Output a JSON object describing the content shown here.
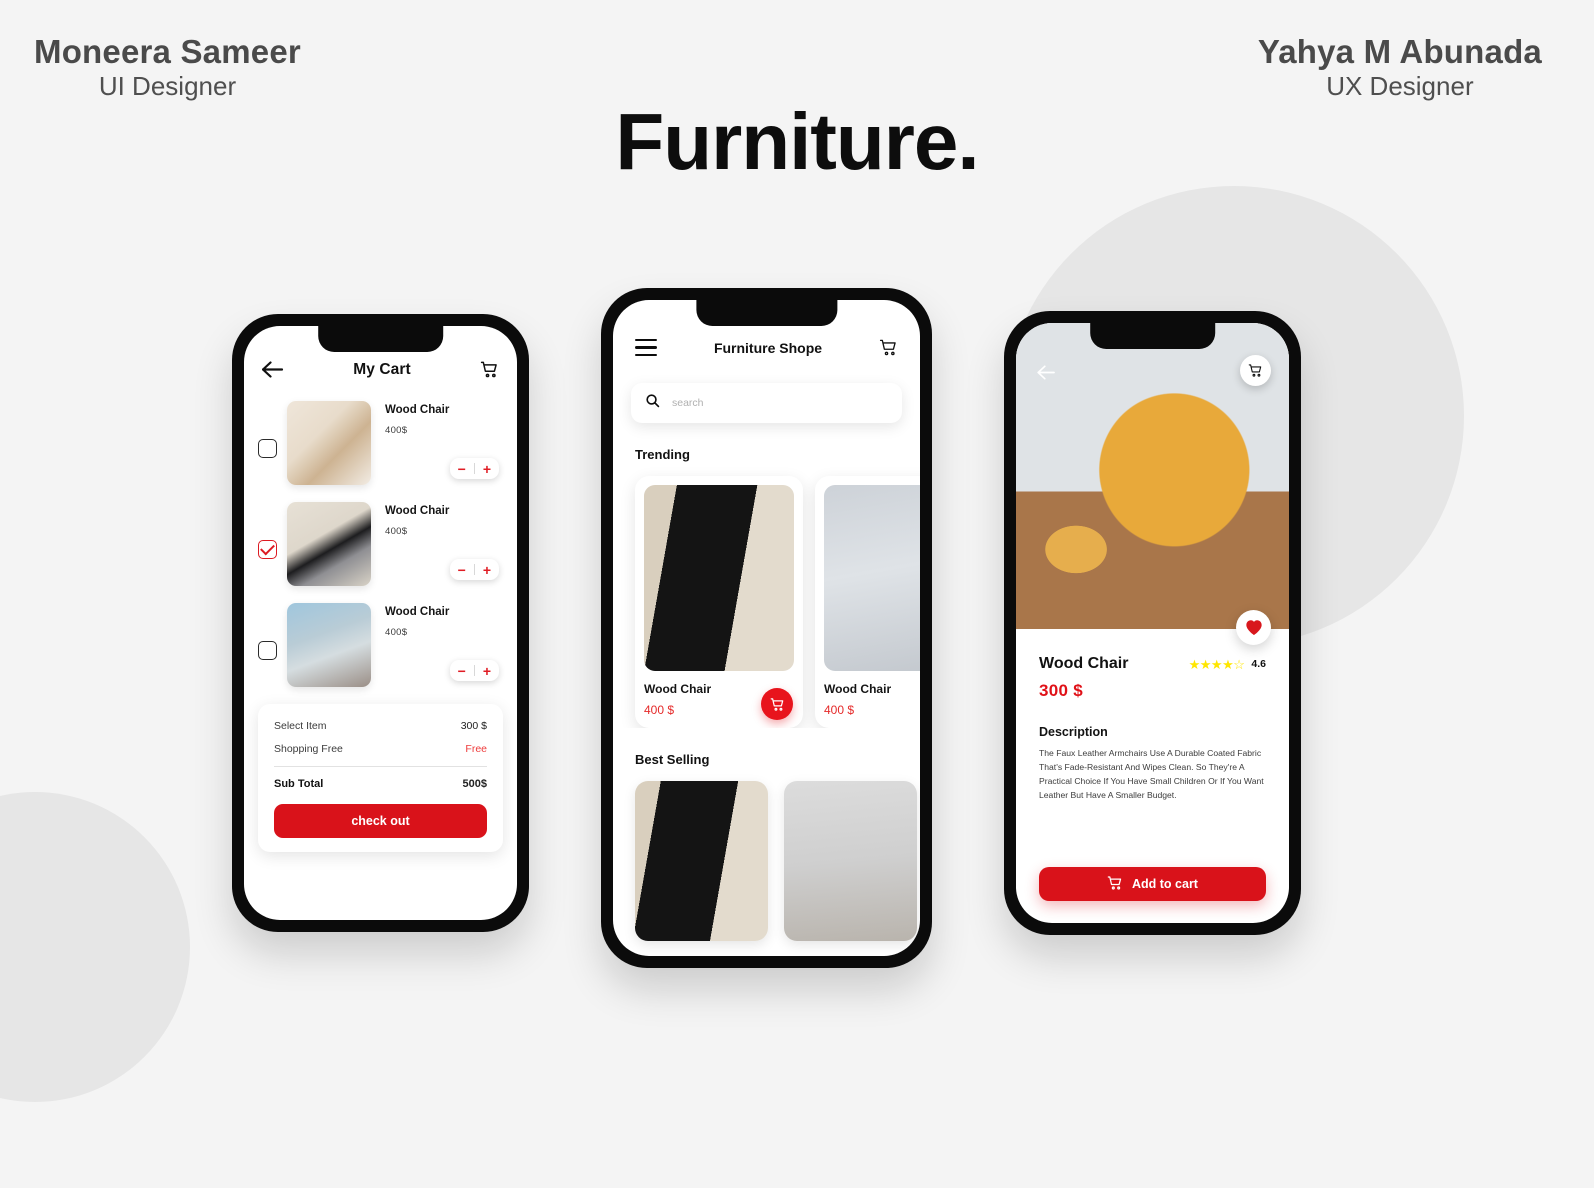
{
  "credits": {
    "left": {
      "name": "Moneera Sameer",
      "role": "UI Designer"
    },
    "right": {
      "name": "Yahya M Abunada",
      "role": "UX Designer"
    }
  },
  "project_title": "Furniture.",
  "theme": {
    "red": "#d9121a",
    "accent_red": "#e8141c",
    "star_yellow": "#ffe600",
    "bg": "#f4f4f4",
    "blob": "#e6e6e6"
  },
  "cart_screen": {
    "title": "My Cart",
    "back_icon": "arrow-left-icon",
    "cart_icon": "shopping-cart-icon",
    "items": [
      {
        "name": "Wood Chair",
        "price": "400$",
        "checked": false,
        "minus": "−",
        "plus": "+"
      },
      {
        "name": "Wood Chair",
        "price": "400$",
        "checked": true,
        "minus": "−",
        "plus": "+"
      },
      {
        "name": "Wood Chair",
        "price": "400$",
        "checked": false,
        "minus": "−",
        "plus": "+"
      }
    ],
    "summary": {
      "select_item_label": "Select Item",
      "select_item_value": "300 $",
      "shipping_label": "Shopping Free",
      "shipping_value": "Free",
      "subtotal_label": "Sub Total",
      "subtotal_value": "500$",
      "checkout_label": "check out"
    }
  },
  "home_screen": {
    "title": "Furniture Shope",
    "menu_icon": "hamburger-menu-icon",
    "cart_icon": "shopping-cart-icon",
    "search": {
      "placeholder": "search",
      "value": "",
      "icon": "search-icon"
    },
    "sections": [
      {
        "heading": "Trending"
      },
      {
        "heading": "Best Selling"
      }
    ],
    "trending": [
      {
        "name": "Wood Chair",
        "price": "400 $",
        "has_add_button": true,
        "add_icon": "shopping-cart-icon"
      },
      {
        "name": "Wood Chair",
        "price": "400 $",
        "has_add_button": false,
        "add_icon": ""
      }
    ],
    "best_selling_count": 2
  },
  "detail_screen": {
    "back_icon": "arrow-left-icon",
    "cart_icon": "shopping-cart-icon",
    "favorite_icon": "heart-icon",
    "name": "Wood Chair",
    "price": "300 $",
    "rating_value": "4.6",
    "stars": "★★★★☆",
    "description_heading": "Description",
    "description": "The Faux Leather Armchairs Use A Durable Coated Fabric That's Fade-Resistant And Wipes Clean. So They're A Practical Choice If You Have Small Children Or If You Want Leather But Have A Smaller Budget.",
    "add_to_cart_label": "Add to  cart",
    "add_to_cart_icon": "shopping-cart-icon"
  }
}
